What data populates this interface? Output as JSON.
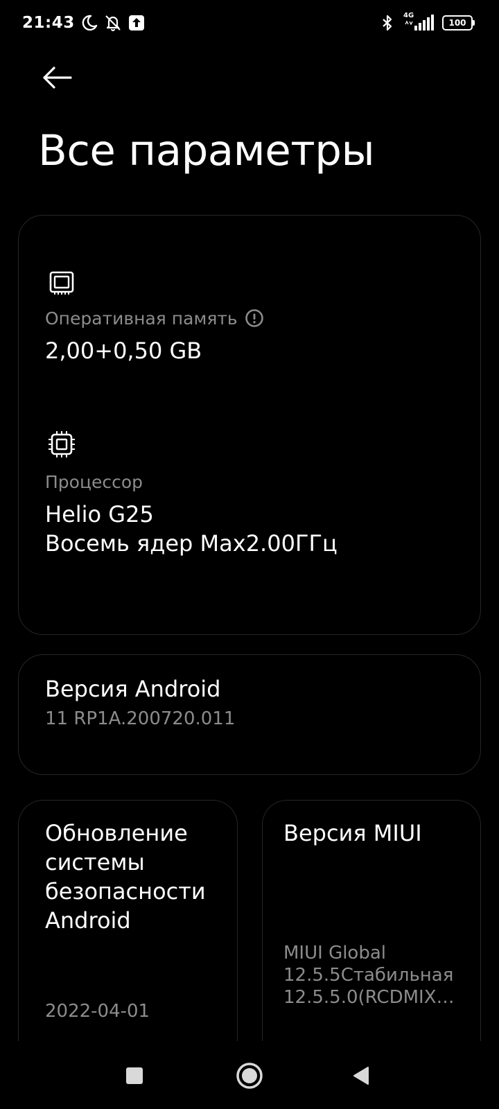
{
  "status_bar": {
    "time": "21:43",
    "left_icons": [
      "moon-icon",
      "bell-off-icon",
      "upload-notification-icon"
    ],
    "right_icons": [
      "bluetooth-icon",
      "signal-4g-icon",
      "battery-icon"
    ],
    "network_type": "4G",
    "battery": "100"
  },
  "header": {
    "back_icon": "arrow-left-icon",
    "title": "Все параметры"
  },
  "specs": {
    "ram": {
      "icon": "memory-chip-icon",
      "label": "Оперативная память",
      "info_icon": "info-icon",
      "value": "2,00+0,50 GB"
    },
    "cpu": {
      "icon": "processor-icon",
      "label": "Процессор",
      "value_line1": "Helio G25",
      "value_line2": "Восемь ядер Max2.00ГГц"
    }
  },
  "android_version": {
    "title": "Версия Android",
    "value": "11 RP1A.200720.011"
  },
  "security_update": {
    "title_lines": [
      "Обновление",
      "системы",
      "безопасности",
      "Android"
    ],
    "value": "2022-04-01"
  },
  "miui_version": {
    "title": "Версия MIUI",
    "value_lines": [
      "MIUI Global",
      "12.5.5Стабильная",
      "12.5.5.0(RCDMIX…"
    ]
  },
  "nav_bar": {
    "buttons": [
      "recents-square-icon",
      "home-circle-icon",
      "back-triangle-icon"
    ]
  },
  "colors": {
    "background": "#000000",
    "card_border": "#262626",
    "primary_text": "#ffffff",
    "secondary_text": "#8c8c8c"
  }
}
